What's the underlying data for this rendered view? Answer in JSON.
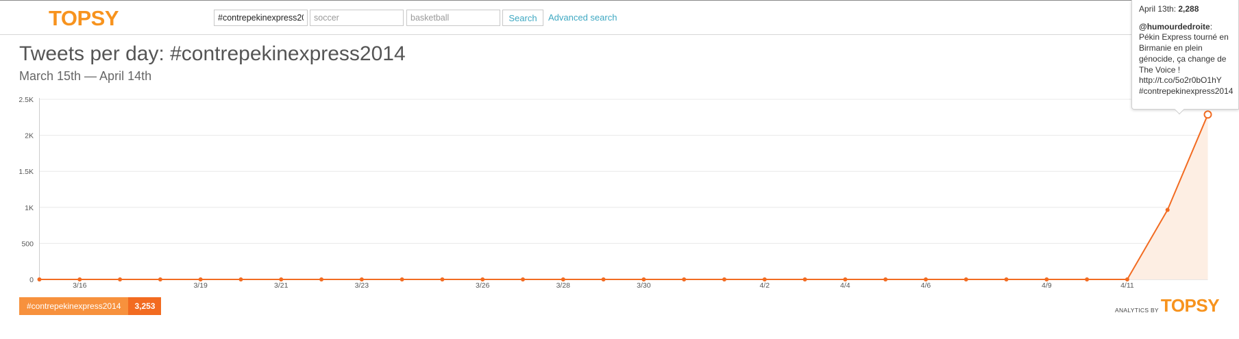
{
  "header": {
    "logo": "TOPSY",
    "queries": [
      {
        "value": "#contrepekinexpress20",
        "placeholder": ""
      },
      {
        "value": "",
        "placeholder": "soccer"
      },
      {
        "value": "",
        "placeholder": "basketball"
      }
    ],
    "search_label": "Search",
    "advanced_label": "Advanced search"
  },
  "page": {
    "title": "Tweets per day: #contrepekinexpress2014",
    "subtitle": "March 15th — April 14th"
  },
  "chart_data": {
    "type": "area",
    "title": "Tweets per day: #contrepekinexpress2014",
    "subtitle": "March 15th — April 14th",
    "xlabel": "",
    "ylabel": "",
    "ylim": [
      0,
      2500
    ],
    "y_ticks": [
      0,
      500,
      1000,
      1500,
      2000,
      2500
    ],
    "y_tick_labels": [
      "0",
      "500",
      "1K",
      "1.5K",
      "2K",
      "2.5K"
    ],
    "x": [
      "3/15",
      "3/16",
      "3/17",
      "3/18",
      "3/19",
      "3/20",
      "3/21",
      "3/22",
      "3/23",
      "3/24",
      "3/25",
      "3/26",
      "3/27",
      "3/28",
      "3/29",
      "3/30",
      "3/31",
      "4/1",
      "4/2",
      "4/3",
      "4/4",
      "4/5",
      "4/6",
      "4/7",
      "4/8",
      "4/9",
      "4/10",
      "4/11",
      "4/12",
      "4/13"
    ],
    "x_tick_labels": [
      "3/16",
      "3/19",
      "3/21",
      "3/23",
      "3/26",
      "3/28",
      "3/30",
      "4/2",
      "4/4",
      "4/6",
      "4/9",
      "4/11"
    ],
    "series": [
      {
        "name": "#contrepekinexpress2014",
        "values": [
          0,
          0,
          0,
          0,
          0,
          0,
          0,
          0,
          0,
          0,
          0,
          0,
          0,
          0,
          0,
          0,
          0,
          0,
          0,
          0,
          0,
          0,
          0,
          0,
          0,
          0,
          0,
          0,
          965,
          2288
        ]
      }
    ],
    "grid": true,
    "colors": {
      "line": "#f26b21",
      "fill": "#fdeee3",
      "grid": "#e8e8e8",
      "axis": "#cccccc"
    },
    "highlight_index": 29
  },
  "legend": {
    "name": "#contrepekinexpress2014",
    "count": "3,253"
  },
  "tooltip": {
    "date": "April 13th:",
    "value": "2,288",
    "user": "@humourdedroite",
    "text": ": Pékin Express tourné en Birmanie en plein génocide, ça change de The Voice ! http://t.co/5o2r0bO1hY #contrepekinexpress2014"
  },
  "branding": {
    "by": "ANALYTICS BY",
    "logo": "TOPSY"
  }
}
